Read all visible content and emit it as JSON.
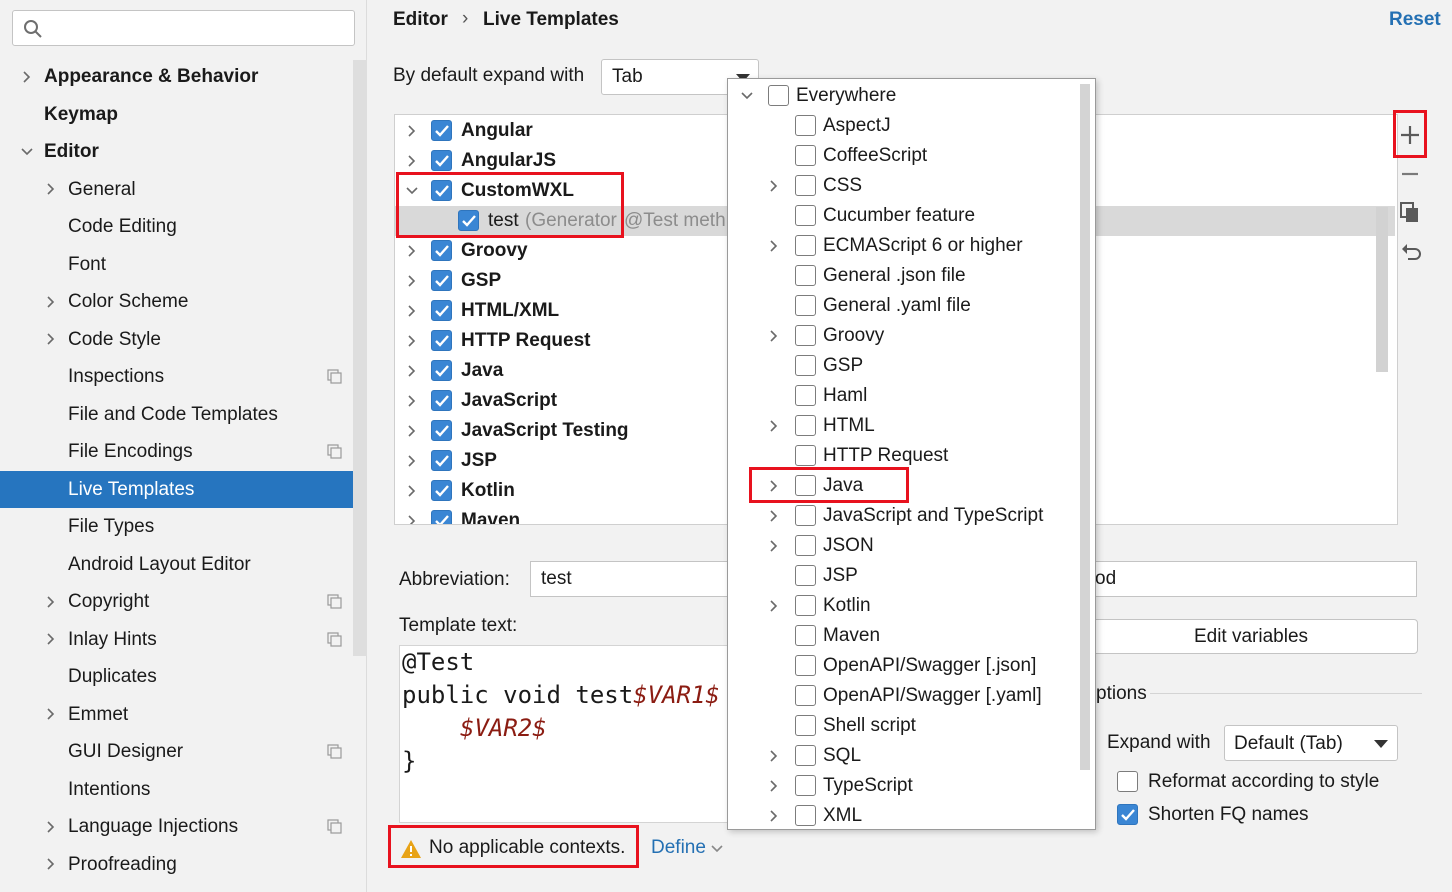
{
  "sidebar": {
    "search_placeholder": "",
    "items": [
      {
        "label": "Appearance & Behavior",
        "bold": true,
        "level": 0,
        "chevron": "right"
      },
      {
        "label": "Keymap",
        "bold": true,
        "level": 0,
        "chevron": "none"
      },
      {
        "label": "Editor",
        "bold": true,
        "level": 0,
        "chevron": "down"
      },
      {
        "label": "General",
        "level": 1,
        "chevron": "right"
      },
      {
        "label": "Code Editing",
        "level": 1,
        "chevron": "none"
      },
      {
        "label": "Font",
        "level": 1,
        "chevron": "none"
      },
      {
        "label": "Color Scheme",
        "level": 1,
        "chevron": "right"
      },
      {
        "label": "Code Style",
        "level": 1,
        "chevron": "right"
      },
      {
        "label": "Inspections",
        "level": 1,
        "chevron": "none",
        "project_icon": true
      },
      {
        "label": "File and Code Templates",
        "level": 1,
        "chevron": "none"
      },
      {
        "label": "File Encodings",
        "level": 1,
        "chevron": "none",
        "project_icon": true
      },
      {
        "label": "Live Templates",
        "level": 1,
        "chevron": "none",
        "selected": true
      },
      {
        "label": "File Types",
        "level": 1,
        "chevron": "none"
      },
      {
        "label": "Android Layout Editor",
        "level": 1,
        "chevron": "none"
      },
      {
        "label": "Copyright",
        "level": 1,
        "chevron": "right",
        "project_icon": true
      },
      {
        "label": "Inlay Hints",
        "level": 1,
        "chevron": "right",
        "project_icon": true
      },
      {
        "label": "Duplicates",
        "level": 1,
        "chevron": "none"
      },
      {
        "label": "Emmet",
        "level": 1,
        "chevron": "right"
      },
      {
        "label": "GUI Designer",
        "level": 1,
        "chevron": "none",
        "project_icon": true
      },
      {
        "label": "Intentions",
        "level": 1,
        "chevron": "none"
      },
      {
        "label": "Language Injections",
        "level": 1,
        "chevron": "right",
        "project_icon": true
      },
      {
        "label": "Proofreading",
        "level": 1,
        "chevron": "right"
      }
    ]
  },
  "header": {
    "breadcrumb_parent": "Editor",
    "breadcrumb_separator": "›",
    "breadcrumb_current": "Live Templates",
    "reset_label": "Reset"
  },
  "expand": {
    "label": "By default expand with",
    "value": "Tab"
  },
  "template_groups": [
    {
      "name": "Angular",
      "checked": true,
      "expanded": false
    },
    {
      "name": "AngularJS",
      "checked": true,
      "expanded": false
    },
    {
      "name": "CustomWXL",
      "checked": true,
      "expanded": true
    },
    {
      "name": "test",
      "checked": true,
      "child": true,
      "desc": "(Generator",
      "desc2": "@Test meth"
    },
    {
      "name": "Groovy",
      "checked": true,
      "expanded": false
    },
    {
      "name": "GSP",
      "checked": true,
      "expanded": false
    },
    {
      "name": "HTML/XML",
      "checked": true,
      "expanded": false
    },
    {
      "name": "HTTP Request",
      "checked": true,
      "expanded": false
    },
    {
      "name": "Java",
      "checked": true,
      "expanded": false
    },
    {
      "name": "JavaScript",
      "checked": true,
      "expanded": false
    },
    {
      "name": "JavaScript Testing",
      "checked": true,
      "expanded": false
    },
    {
      "name": "JSP",
      "checked": true,
      "expanded": false
    },
    {
      "name": "Kotlin",
      "checked": true,
      "expanded": false
    },
    {
      "name": "Maven",
      "checked": true,
      "expanded": false
    }
  ],
  "editor": {
    "abbreviation_label": "Abbreviation:",
    "abbreviation_value": "test",
    "description_tail": "od",
    "template_text_label": "Template text:",
    "code_line1": "@Test",
    "code_line2_a": "public void test",
    "code_line2_var": "$VAR1$",
    "code_line3_var": "$VAR2$",
    "code_line4": "}",
    "edit_variables_label": "Edit variables",
    "options_tail": "ptions",
    "expand_with_label": "Expand with",
    "expand_with_value": "Default (Tab)",
    "reformat_label": "Reformat according to style",
    "reformat_checked": false,
    "shorten_label": "Shorten FQ names",
    "shorten_checked": true,
    "warning_text": "No applicable contexts.",
    "define_label": "Define"
  },
  "context_popup": {
    "root": "Everywhere",
    "items": [
      {
        "label": "AspectJ",
        "expandable": false
      },
      {
        "label": "CoffeeScript",
        "expandable": false
      },
      {
        "label": "CSS",
        "expandable": true
      },
      {
        "label": "Cucumber feature",
        "expandable": false
      },
      {
        "label": "ECMAScript 6 or higher",
        "expandable": true
      },
      {
        "label": "General .json file",
        "expandable": false
      },
      {
        "label": "General .yaml file",
        "expandable": false
      },
      {
        "label": "Groovy",
        "expandable": true
      },
      {
        "label": "GSP",
        "expandable": false
      },
      {
        "label": "Haml",
        "expandable": false
      },
      {
        "label": "HTML",
        "expandable": true
      },
      {
        "label": "HTTP Request",
        "expandable": false
      },
      {
        "label": "Java",
        "expandable": true
      },
      {
        "label": "JavaScript and TypeScript",
        "expandable": true
      },
      {
        "label": "JSON",
        "expandable": true
      },
      {
        "label": "JSP",
        "expandable": false
      },
      {
        "label": "Kotlin",
        "expandable": true
      },
      {
        "label": "Maven",
        "expandable": false
      },
      {
        "label": "OpenAPI/Swagger [.json]",
        "expandable": false
      },
      {
        "label": "OpenAPI/Swagger [.yaml]",
        "expandable": false
      },
      {
        "label": "Shell script",
        "expandable": false
      },
      {
        "label": "SQL",
        "expandable": true
      },
      {
        "label": "TypeScript",
        "expandable": true
      },
      {
        "label": "XML",
        "expandable": true
      }
    ]
  },
  "toolbar_icons": [
    "add-icon",
    "remove-icon",
    "copy-icon",
    "restore-icon"
  ],
  "colors": {
    "accent": "#2675bf",
    "checkbox": "#3a86d4",
    "highlight_border": "#e8121e",
    "link": "#2470b3",
    "variable": "#8b1c12",
    "warning": "#e8a317"
  }
}
